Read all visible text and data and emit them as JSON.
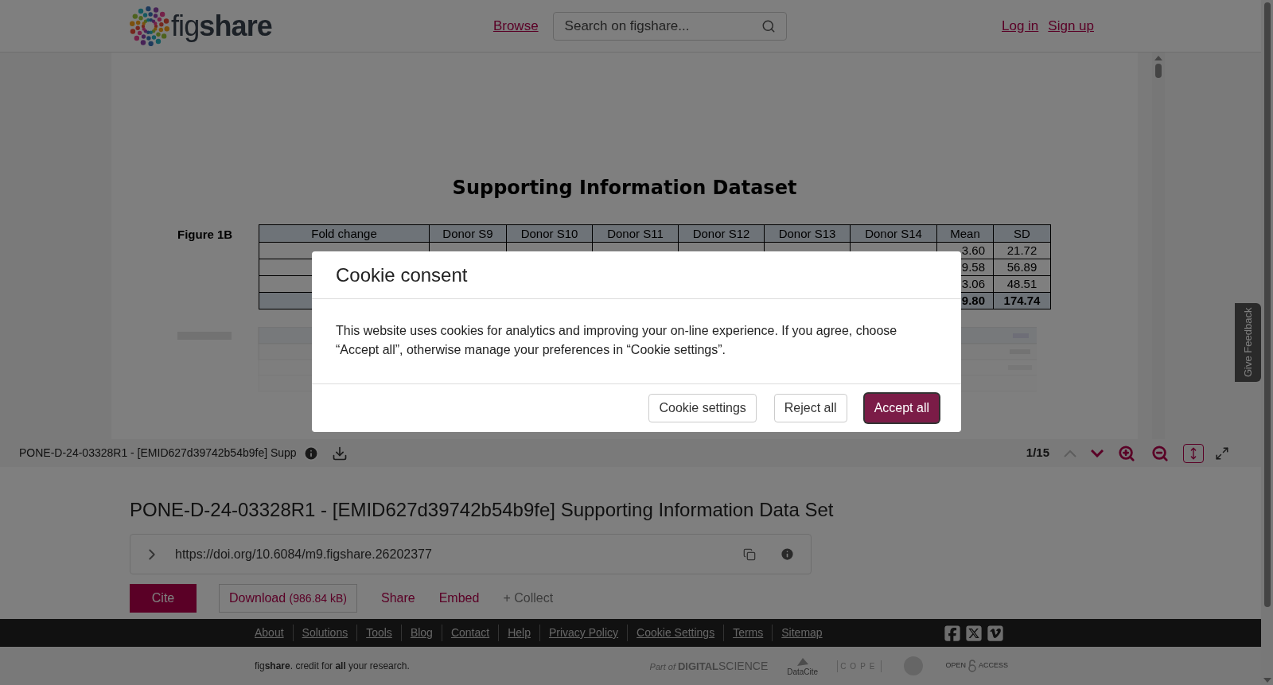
{
  "header": {
    "logo": "fig**share**",
    "browse": "Browse",
    "search": {
      "placeholder": "Search on figshare..."
    },
    "log_in": "Log in",
    "sign_up": "Sign up"
  },
  "viewer": {
    "document": {
      "title": "Supporting Information Dataset",
      "figures": [
        {
          "label": "Figure 1B",
          "columns": [
            "Fold change",
            "Donor S9",
            "Donor S10",
            "Donor S11",
            "Donor S12",
            "Donor S13",
            "Donor S14",
            "Mean",
            "SD"
          ],
          "rows": [
            {
              "kind": "data",
              "mean": "3.60",
              "sd": "21.72"
            },
            {
              "kind": "data",
              "mean": "9.58",
              "sd": "56.89"
            },
            {
              "kind": "data",
              "mean": "3.06",
              "sd": "48.51"
            },
            {
              "kind": "total",
              "mean": "9.80",
              "sd": "174.74"
            }
          ]
        }
      ]
    },
    "toolbar": {
      "file_name": "PONE-D-24-03328R1 - [EMID627d39742b54b9fe] Supp",
      "page": "1/15",
      "previous_disabled": true,
      "next_disabled": false,
      "fit_height_selected": true
    }
  },
  "feedback_tab": "Give Feedback",
  "item": {
    "title": "PONE-D-24-03328R1 - [EMID627d39742b54b9fe] Supporting Information Data Set",
    "doi": "https://doi.org/10.6084/m9.figshare.26202377",
    "cite": "Cite",
    "download": "Download",
    "download_size": "(986.84 kB)",
    "share": "Share",
    "embed": "Embed",
    "collect": "+ Collect"
  },
  "footer": {
    "links": [
      "About",
      "Solutions",
      "Tools",
      "Blog",
      "Contact",
      "Help",
      "Privacy Policy",
      "Cookie Settings",
      "Terms",
      "Sitemap"
    ],
    "tagline": "fig**share**. credit for **all** your research.",
    "partners": [
      {
        "kind": "digital_science",
        "label_1": "Part of",
        "label_2": "DIGITAL",
        "label_3": "SCIENCE"
      },
      {
        "kind": "datacite",
        "label": "DataCite"
      },
      {
        "kind": "cope",
        "label": "COPE"
      },
      {
        "kind": "seal"
      },
      {
        "kind": "open_access",
        "label_1": "OPEN",
        "label_2": "ACCESS"
      }
    ]
  },
  "cookie_dialog": {
    "title": "Cookie consent",
    "text": "This website uses cookies for analytics and improving your on-line experience. If you agree, choose “Accept all”, otherwise manage your preferences in “Cookie settings”.",
    "buttons": [
      {
        "label": "Cookie settings",
        "kind": "secondary"
      },
      {
        "label": "Reject all",
        "kind": "secondary"
      },
      {
        "label": "Accept all",
        "kind": "primary"
      }
    ]
  }
}
